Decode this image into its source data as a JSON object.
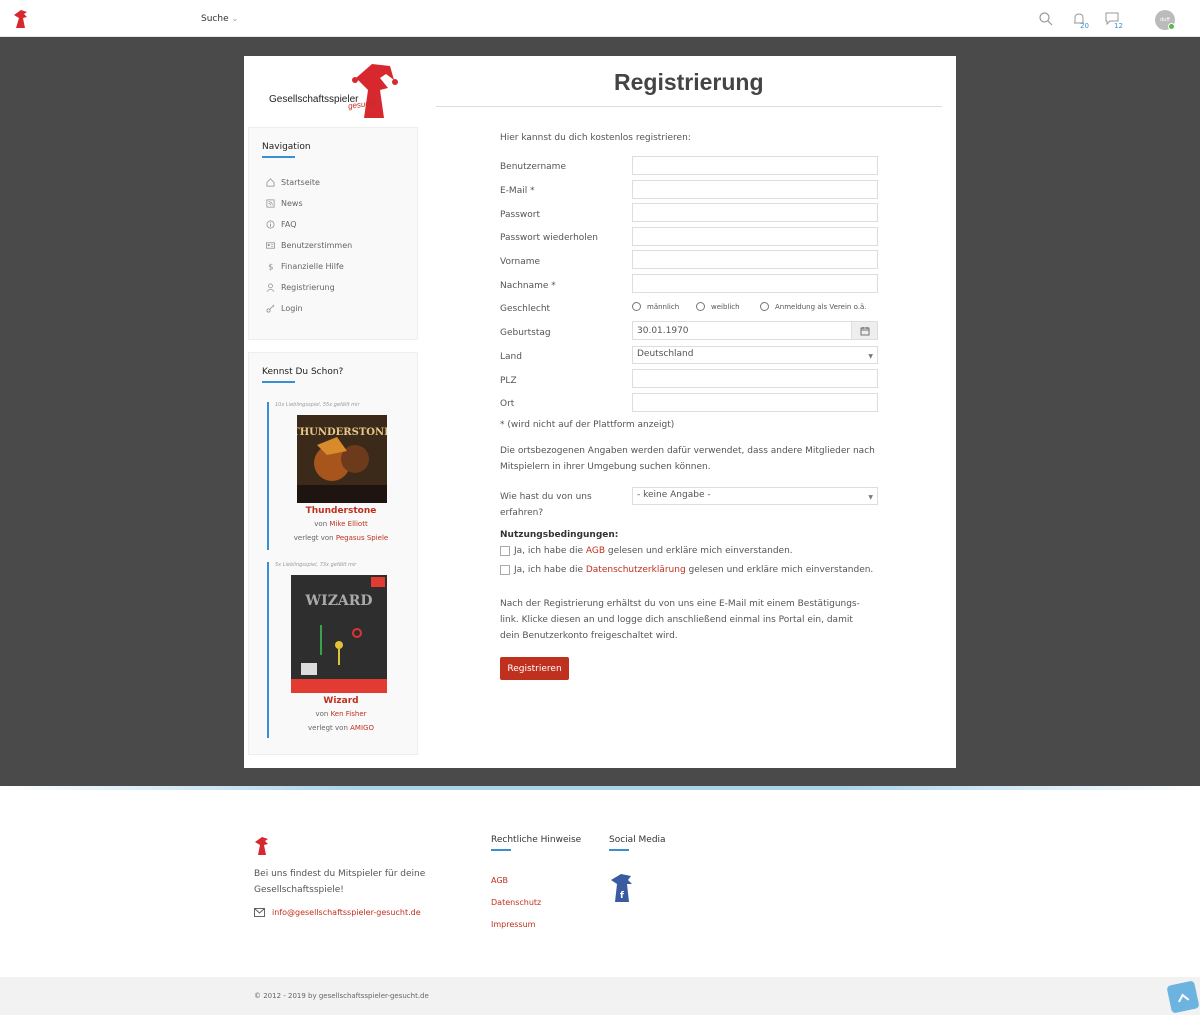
{
  "topbar": {
    "search_label": "Suche",
    "search_caret": "⌄",
    "notifications_count": "20",
    "messages_count": "12",
    "avatar_text": "duff"
  },
  "sidebar": {
    "brand_main": "Gesellschaftsspieler",
    "brand_sub": "gesucht",
    "nav_title": "Navigation",
    "nav_items": [
      {
        "label": "Startseite",
        "icon": "home-icon"
      },
      {
        "label": "News",
        "icon": "rss-icon"
      },
      {
        "label": "FAQ",
        "icon": "info-icon"
      },
      {
        "label": "Benutzerstimmen",
        "icon": "id-card-icon"
      },
      {
        "label": "Finanzielle Hilfe",
        "icon": "dollar-icon"
      },
      {
        "label": "Registrierung",
        "icon": "user-icon"
      },
      {
        "label": "Login",
        "icon": "key-icon"
      }
    ],
    "know_title": "Kennst Du Schon?",
    "games": [
      {
        "meta": "10x Lieblingsspiel, 55x gefällt mir",
        "title": "Thunderstone",
        "von": "von ",
        "author": "Mike Elliott",
        "verlegt": "verlegt von ",
        "publisher": "Pegasus Spiele",
        "cover_title": "THUNDERSTONE"
      },
      {
        "meta": "5x Lieblingsspiel, 73x gefällt mir",
        "title": "Wizard",
        "von": "von ",
        "author": "Ken Fisher",
        "verlegt": "verlegt von ",
        "publisher": "AMIGO",
        "cover_title": "WIZARD"
      }
    ]
  },
  "form": {
    "title": "Registrierung",
    "intro": "Hier kannst du dich kostenlos registrieren:",
    "labels": {
      "username": "Benutzername",
      "email": "E-Mail *",
      "password": "Passwort",
      "password_repeat": "Passwort wiederholen",
      "firstname": "Vorname",
      "lastname": "Nachname *",
      "gender": "Geschlecht",
      "birthday": "Geburtstag",
      "country": "Land",
      "zip": "PLZ",
      "city": "Ort",
      "found_us_1": "Wie hast du von uns",
      "found_us_2": "erfahren?"
    },
    "gender_options": [
      "männlich",
      "weiblich",
      "Anmeldung als Verein o.ä."
    ],
    "birthday_value": "30.01.1970",
    "country_value": "Deutschland",
    "found_us_value": "- keine Angabe -",
    "note": "* (wird nicht auf der Plattform anzeigt)",
    "location_info_1": "Die ortsbezogenen Angaben werden dafür verwendet, dass andere Mitglieder nach",
    "location_info_2": "Mitspielern in ihrer Umgebung suchen können.",
    "terms_title": "Nutzungsbedingungen:",
    "agb_pre": "Ja, ich habe die ",
    "agb_link": "AGB",
    "agb_post": " gelesen und erkläre mich einverstanden.",
    "privacy_pre": "Ja, ich habe die ",
    "privacy_link": "Datenschutzerklärung",
    "privacy_post": " gelesen und erkläre mich einverstanden.",
    "after_1": "Nach der Registrierung erhältst du von uns eine E-Mail mit einem Bestätigungs-",
    "after_2": "link. Klicke diesen an und logge dich anschließend einmal ins Portal ein, damit",
    "after_3": "dein Benutzerkonto freigeschaltet wird.",
    "submit": "Registrieren"
  },
  "footer": {
    "tagline_1": "Bei uns findest du Mitspieler für deine",
    "tagline_2": "Gesellschaftsspiele!",
    "email": "info@gesellschaftsspieler-gesucht.de",
    "legal_title": "Rechtliche Hinweise",
    "legal_links": [
      "AGB",
      "Datenschutz",
      "Impressum"
    ],
    "social_title": "Social Media",
    "copyright": "© 2012 - 2019 by gesellschaftsspieler-gesucht.de"
  },
  "colors": {
    "accent": "#c0301e",
    "blue": "#3a8fd0",
    "band": "#4a4a4a"
  }
}
